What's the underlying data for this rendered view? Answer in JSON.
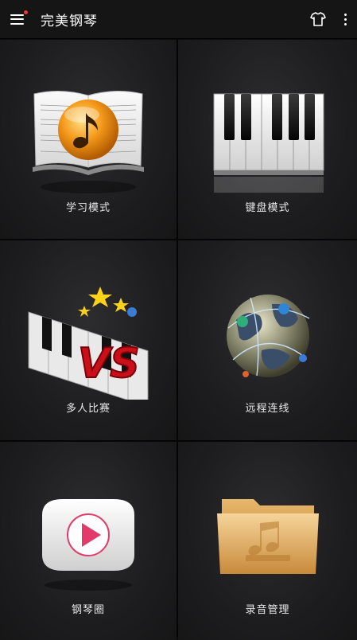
{
  "appbar": {
    "title": "完美钢琴",
    "menu_icon": "hamburger-menu-icon",
    "theme_icon": "tshirt-icon",
    "more_icon": "more-vertical-icon",
    "badge_color": "#e53935"
  },
  "tiles": [
    {
      "label": "学习模式",
      "icon": "music-book-icon"
    },
    {
      "label": "键盘模式",
      "icon": "piano-keys-icon"
    },
    {
      "label": "多人比赛",
      "icon": "piano-vs-icon"
    },
    {
      "label": "远程连线",
      "icon": "globe-network-icon"
    },
    {
      "label": "钢琴圈",
      "icon": "play-video-icon"
    },
    {
      "label": "录音管理",
      "icon": "folder-music-icon"
    }
  ]
}
